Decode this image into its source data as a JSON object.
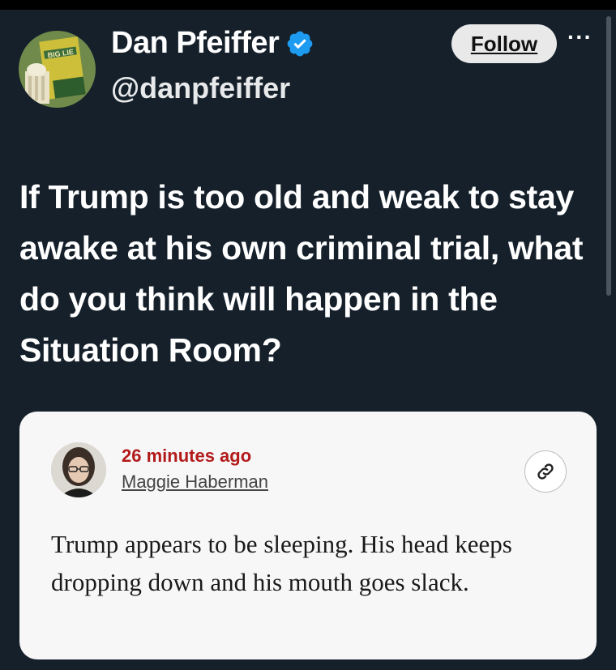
{
  "tweet": {
    "author_name": "Dan Pfeiffer",
    "handle": "@danpfeiffer",
    "follow_label": "Follow",
    "more_label": "···",
    "avatar_book_title": "BIG LIE",
    "text": "If Trump is too old and weak to stay awake at his own criminal trial, what do you think will happen in the Situation Room?"
  },
  "embedded_card": {
    "time": "26 minutes ago",
    "author": "Maggie Haberman",
    "text": "Trump appears to be sleeping. His head keeps dropping down and his mouth goes slack."
  },
  "colors": {
    "background": "#15202b",
    "verified_badge": "#1d9bf0",
    "card_background": "#f7f7f7",
    "time_red": "#b31b1b"
  },
  "icons": {
    "verified": "verified-badge-icon",
    "link": "link-icon",
    "more": "more-icon"
  }
}
